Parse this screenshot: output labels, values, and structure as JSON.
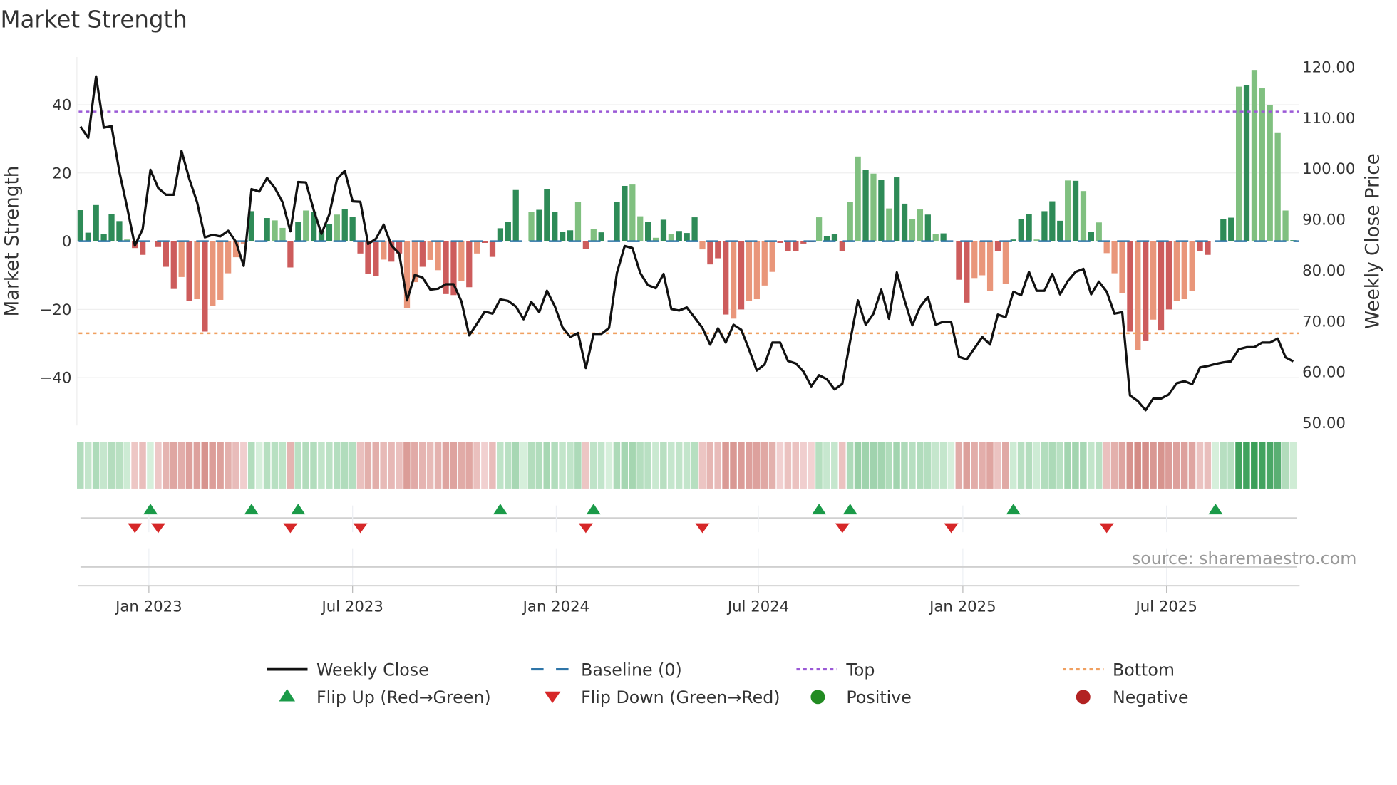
{
  "title": "Market Strength",
  "source": "source: sharemaestro.com",
  "colors": {
    "pos_dark": "#2e8b57",
    "pos_light": "#80c080",
    "neg_dark": "#cd5c5c",
    "neg_light": "#e9967a",
    "close": "#111111",
    "baseline": "#2e75a8",
    "top": "#9b59d6",
    "bottom": "#f0a060",
    "flip_up": "#1a9a48",
    "flip_down": "#d62728",
    "positive": "#228b22",
    "negative": "#b22222"
  },
  "chart_data": {
    "type": "bar+line",
    "title": "Market Strength",
    "ylabel": "Market Strength",
    "y2label": "Weekly Close Price",
    "ylim": [
      -54,
      54
    ],
    "y2lim": [
      49.3,
      121.8
    ],
    "yticks": [
      40,
      20,
      0,
      -20,
      -40
    ],
    "yticklabels": [
      "40",
      "20",
      "0",
      "−20",
      "−40"
    ],
    "y2ticks": [
      120,
      110,
      100,
      90,
      80,
      70,
      60,
      50
    ],
    "y2ticklabels": [
      "120.00",
      "110.00",
      "100.00",
      "90.00",
      "80.00",
      "70.00",
      "60.00",
      "50.00"
    ],
    "top_level": 38,
    "bottom_level": -27,
    "baseline": 0,
    "xticks": [
      {
        "week": 8.8,
        "label": "Jan 2023"
      },
      {
        "week": 35,
        "label": "Jul 2023"
      },
      {
        "week": 61.2,
        "label": "Jan 2024"
      },
      {
        "week": 87.2,
        "label": "Jul 2024"
      },
      {
        "week": 113.5,
        "label": "Jan 2025"
      },
      {
        "week": 139.7,
        "label": "Jul 2025"
      }
    ],
    "strength": [
      9.1,
      2.5,
      10.6,
      2,
      8,
      5.9,
      0.5,
      -2,
      -4,
      0,
      -1.7,
      -7.5,
      -14,
      -10.5,
      -17.5,
      -17,
      -26.5,
      -19,
      -17.2,
      -9.4,
      -4.7,
      -0.7,
      8.8,
      0,
      6.8,
      6.1,
      3.9,
      -7.7,
      5.6,
      9,
      8.6,
      3,
      5,
      7.8,
      9.5,
      7.2,
      -3.6,
      -9.5,
      -10.3,
      -5.4,
      -6,
      -3.6,
      -19.5,
      -12,
      -7.5,
      -5.5,
      -8.5,
      -15.5,
      -15.8,
      -11.7,
      -13.5,
      -3.6,
      -0.5,
      -4.6,
      3.8,
      5.7,
      15,
      0,
      8.5,
      9.2,
      15.3,
      8.6,
      2.7,
      3.2,
      11.4,
      -2.2,
      3.5,
      2.6,
      0,
      11.6,
      16.2,
      16.6,
      7.3,
      5.7,
      1,
      6.3,
      2,
      3,
      2.4,
      7,
      -2.4,
      -6.8,
      -5,
      -21.5,
      -22.7,
      -20,
      -17.5,
      -17,
      -13,
      -9,
      -0.5,
      -3,
      -3,
      -0.7,
      -0.3,
      7,
      1.5,
      2,
      -3,
      11.4,
      24.8,
      20.8,
      19.8,
      18,
      9.6,
      18.7,
      11,
      6.4,
      9.3,
      7.8,
      2,
      2.3,
      0,
      -11.3,
      -18,
      -10.8,
      -10,
      -14.6,
      -2.8,
      -12.6,
      0.5,
      6.5,
      8,
      0.5,
      8.8,
      11.7,
      6,
      17.8,
      17.7,
      14.7,
      2.8,
      5.5,
      -3.5,
      -9.4,
      -15.2,
      -26.5,
      -32,
      -29.3,
      -23,
      -26,
      -20,
      -17.5,
      -17,
      -14.7,
      -2.8,
      -4,
      0,
      6.4,
      6.9,
      45.3,
      45.7,
      50.2,
      44.8,
      40,
      31.7,
      9,
      0.3
    ],
    "shade": "ddddddlddddddldldllllldddllddldddldddddlddlldllddldldddddlldddddldlddddlldldldddldddldlllldddddldddlldldlddlldldlddllldldddldddldldlllldldlddllldddddldllllldddddllldd",
    "close": [
      108.1,
      105.9,
      118.0,
      107.9,
      108.2,
      99.2,
      92.2,
      84.7,
      87.9,
      99.6,
      96.0,
      94.7,
      94.7,
      103.3,
      97.8,
      93.2,
      86.3,
      86.8,
      86.5,
      87.6,
      85.4,
      80.7,
      95.8,
      95.3,
      98.0,
      96.0,
      93.2,
      87.5,
      97.2,
      97.1,
      91.7,
      87.0,
      90.8,
      97.8,
      99.4,
      93.4,
      93.3,
      85.0,
      86.0,
      88.8,
      84.7,
      83.1,
      73.9,
      78.9,
      78.4,
      76.0,
      76.2,
      77.1,
      77.1,
      73.7,
      67.0,
      69.3,
      71.7,
      71.3,
      74.1,
      73.8,
      72.7,
      70.2,
      73.6,
      71.6,
      75.8,
      72.8,
      68.6,
      66.7,
      67.5,
      60.6,
      67.3,
      67.3,
      68.5,
      79.3,
      84.6,
      84.2,
      79.3,
      76.9,
      76.3,
      79.1,
      72.2,
      71.9,
      72.5,
      70.5,
      68.5,
      65.2,
      68.4,
      65.6,
      69.1,
      68.1,
      64.2,
      60.1,
      61.3,
      65.6,
      65.6,
      62.0,
      61.5,
      59.9,
      57.0,
      59.2,
      58.4,
      56.4,
      57.5,
      65.9,
      73.9,
      69.1,
      71.3,
      76.0,
      70.3,
      79.4,
      73.9,
      69.0,
      72.6,
      74.6,
      69.1,
      69.7,
      69.6,
      62.8,
      62.3,
      64.5,
      66.7,
      65.2,
      71.1,
      70.6,
      75.6,
      74.9,
      79.5,
      75.8,
      75.8,
      79.1,
      75.1,
      77.7,
      79.5,
      80.1,
      75.1,
      77.6,
      75.6,
      71.3,
      71.6,
      55.2,
      54.1,
      52.3,
      54.6,
      54.6,
      55.4,
      57.6,
      58.0,
      57.4,
      60.7,
      61.0,
      61.4,
      61.7,
      61.9,
      64.3,
      64.7,
      64.7,
      65.6,
      65.6,
      66.4,
      62.7,
      61.9
    ],
    "flip_up_weeks": [
      9,
      22,
      28,
      54,
      66,
      95,
      99,
      120,
      146
    ],
    "flip_down_weeks": [
      7,
      10,
      27,
      36,
      65,
      80,
      98,
      112,
      132
    ]
  },
  "legend": {
    "placement": "bottom",
    "items": [
      {
        "key": "weekly-close",
        "label": "Weekly Close"
      },
      {
        "key": "baseline",
        "label": "Baseline (0)"
      },
      {
        "key": "top",
        "label": "Top"
      },
      {
        "key": "bottom",
        "label": "Bottom"
      },
      {
        "key": "flip-up",
        "label": "Flip Up (Red→Green)"
      },
      {
        "key": "flip-down",
        "label": "Flip Down (Green→Red)"
      },
      {
        "key": "positive",
        "label": "Positive"
      },
      {
        "key": "negative",
        "label": "Negative"
      }
    ]
  }
}
